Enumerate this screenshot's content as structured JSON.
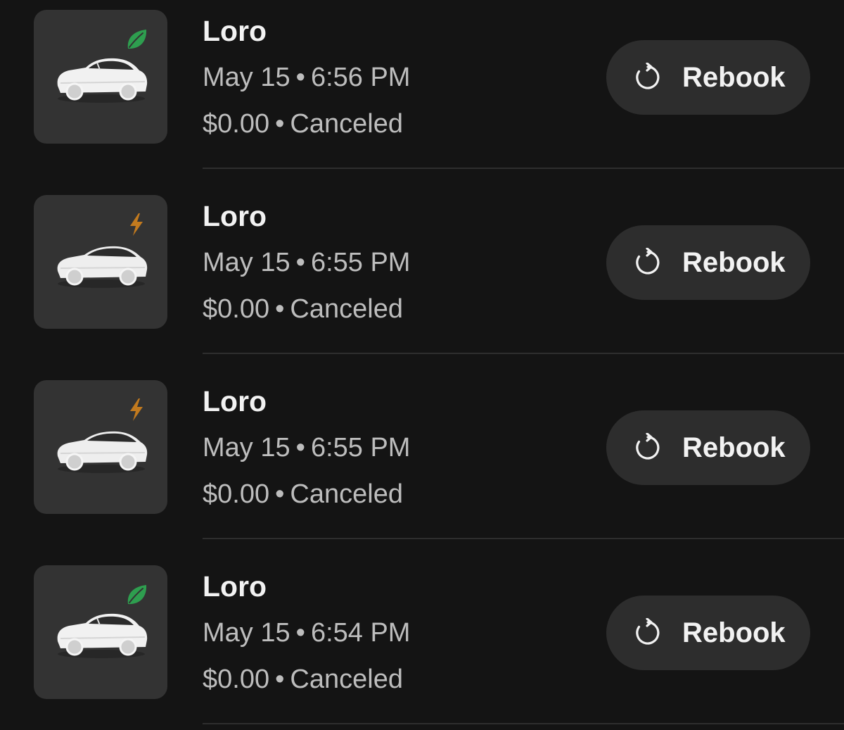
{
  "trips": [
    {
      "service": "Loro",
      "date": "May 15",
      "time": "6:56 PM",
      "price": "$0.00",
      "status": "Canceled",
      "badge_icon": "leaf-icon",
      "badge_color": "#2e9e4f",
      "action_label": "Rebook"
    },
    {
      "service": "Loro",
      "date": "May 15",
      "time": "6:55 PM",
      "price": "$0.00",
      "status": "Canceled",
      "badge_icon": "lightning-bolt-icon",
      "badge_color": "#c27a1e",
      "action_label": "Rebook"
    },
    {
      "service": "Loro",
      "date": "May 15",
      "time": "6:55 PM",
      "price": "$0.00",
      "status": "Canceled",
      "badge_icon": "lightning-bolt-icon",
      "badge_color": "#c27a1e",
      "action_label": "Rebook"
    },
    {
      "service": "Loro",
      "date": "May 15",
      "time": "6:54 PM",
      "price": "$0.00",
      "status": "Canceled",
      "badge_icon": "leaf-icon",
      "badge_color": "#2e9e4f",
      "action_label": "Rebook"
    }
  ],
  "separator": "•",
  "colors": {
    "background": "#141414",
    "thumbnail": "#333333",
    "button": "#2d2d2d",
    "primary_text": "#f2f2f2",
    "secondary_text": "#bdbdbd"
  }
}
